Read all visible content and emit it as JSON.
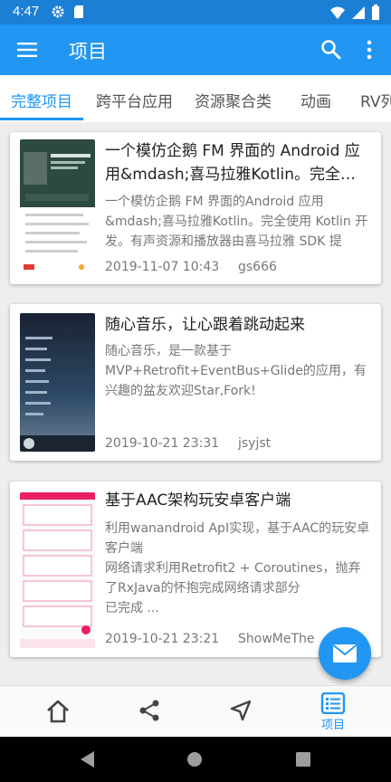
{
  "status_bar": {
    "time": "4:47",
    "left_icons": [
      "gear-icon",
      "sd-card-icon"
    ],
    "right_icons": [
      "wifi-icon",
      "signal-icon",
      "battery-icon"
    ]
  },
  "app_bar": {
    "title": "项目",
    "actions": [
      "search-icon",
      "more-vert-icon"
    ]
  },
  "tabs": [
    {
      "label": "完整项目",
      "active": true
    },
    {
      "label": "跨平台应用",
      "active": false
    },
    {
      "label": "资源聚合类",
      "active": false
    },
    {
      "label": "动画",
      "active": false
    },
    {
      "label": "RV列",
      "active": false
    }
  ],
  "projects": [
    {
      "title": "一个模仿企鹅 FM 界面的 Android 应用&mdash;喜马拉雅Kotlin。完全使用 ...",
      "desc": "一个模仿企鹅 FM 界面的Android 应用&mdash;喜马拉雅Kotlin。完全使用 Kotlin 开发。有声资源和播放器由喜马拉雅 SDK 提",
      "date": "2019-11-07 10:43",
      "author": "gs666"
    },
    {
      "title": "随心音乐，让心跟着跳动起来",
      "desc": "随心音乐，是一款基于MVP+Retrofit+EventBus+Glide的应用，有兴趣的盆友欢迎Star,Fork!",
      "date": "2019-10-21 23:31",
      "author": "jsyjst"
    },
    {
      "title": "基于AAC架构玩安卓客户端",
      "desc": "利用wanandroid ApI实现，基于AAC的玩安卓客户端\n网络请求利用Retrofit2 + Coroutines，抛弃了RxJava的怀抱完成网络请求部分\n已完成 ...",
      "date": "2019-10-21 23:21",
      "author": "ShowMeThe"
    }
  ],
  "fab": {
    "icon": "mail-icon"
  },
  "bottom_nav": [
    {
      "icon": "home-icon",
      "label": "",
      "active": false
    },
    {
      "icon": "share-icon",
      "label": "",
      "active": false
    },
    {
      "icon": "navigation-icon",
      "label": "",
      "active": false
    },
    {
      "icon": "project-list-icon",
      "label": "项目",
      "active": true
    }
  ],
  "system_nav": [
    "back-icon",
    "home-circle-icon",
    "recents-icon"
  ],
  "colors": {
    "primary": "#2196f3",
    "status_bar": "#1c7fd6",
    "text_primary": "#222222",
    "text_secondary": "#777777"
  }
}
